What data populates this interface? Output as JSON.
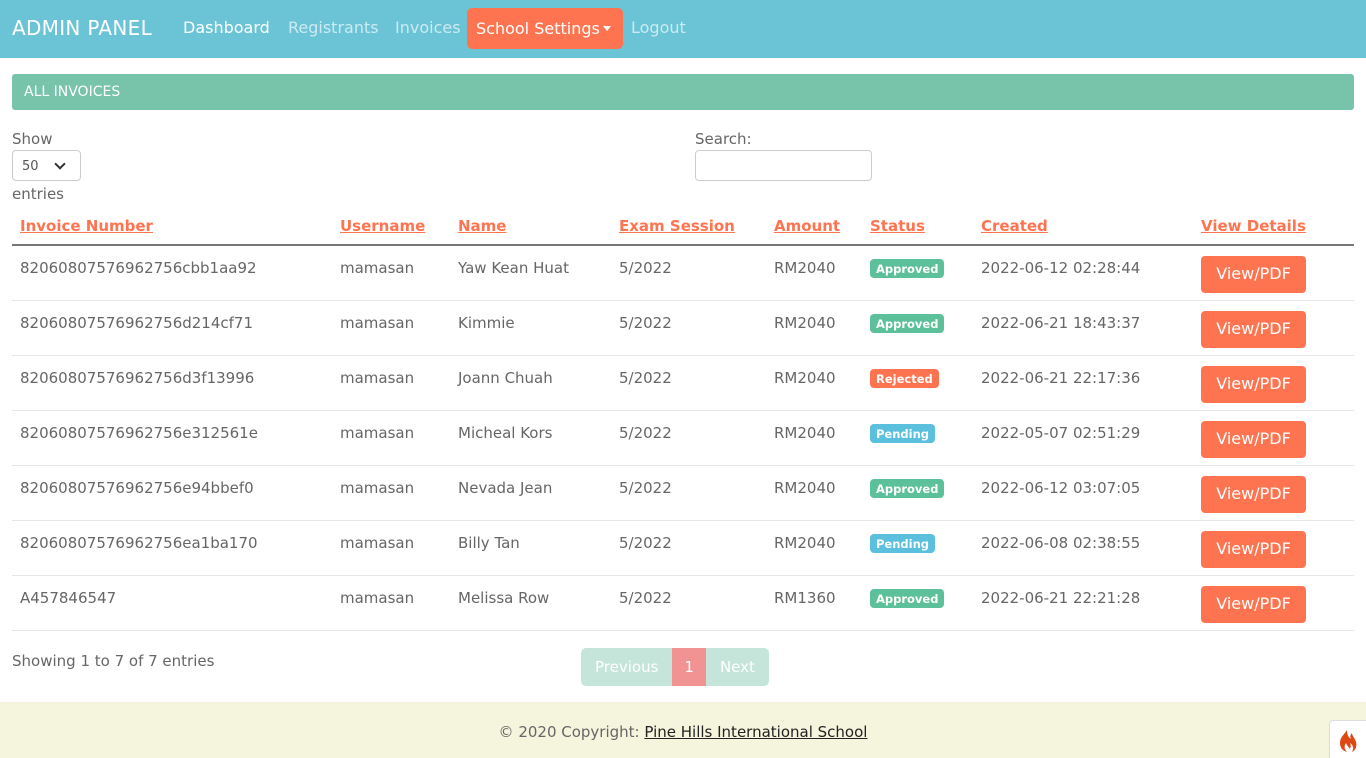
{
  "nav": {
    "brand": "ADMIN PANEL",
    "dashboard": "Dashboard",
    "registrants": "Registrants",
    "invoices": "Invoices",
    "school_settings": "School Settings",
    "logout": "Logout"
  },
  "card": {
    "title": "ALL INVOICES"
  },
  "controls": {
    "show_label": "Show",
    "entries_value": "50",
    "entries_label": "entries",
    "search_label": "Search:",
    "search_value": ""
  },
  "table": {
    "columns": [
      "Invoice Number",
      "Username",
      "Name",
      "Exam Session",
      "Amount",
      "Status",
      "Created",
      "View Details"
    ],
    "rows": [
      {
        "invoice": "82060807576962756cbb1aa92",
        "username": "mamasan",
        "name": "Yaw Kean Huat",
        "session": "5/2022",
        "amount": "RM2040",
        "status": "Approved",
        "created": "2022-06-12 02:28:44",
        "action": "View/PDF"
      },
      {
        "invoice": "82060807576962756d214cf71",
        "username": "mamasan",
        "name": "Kimmie",
        "session": "5/2022",
        "amount": "RM2040",
        "status": "Approved",
        "created": "2022-06-21 18:43:37",
        "action": "View/PDF"
      },
      {
        "invoice": "82060807576962756d3f13996",
        "username": "mamasan",
        "name": "Joann Chuah",
        "session": "5/2022",
        "amount": "RM2040",
        "status": "Rejected",
        "created": "2022-06-21 22:17:36",
        "action": "View/PDF"
      },
      {
        "invoice": "82060807576962756e312561e",
        "username": "mamasan",
        "name": "Micheal Kors",
        "session": "5/2022",
        "amount": "RM2040",
        "status": "Pending",
        "created": "2022-05-07 02:51:29",
        "action": "View/PDF"
      },
      {
        "invoice": "82060807576962756e94bbef0",
        "username": "mamasan",
        "name": "Nevada Jean",
        "session": "5/2022",
        "amount": "RM2040",
        "status": "Approved",
        "created": "2022-06-12 03:07:05",
        "action": "View/PDF"
      },
      {
        "invoice": "82060807576962756ea1ba170",
        "username": "mamasan",
        "name": "Billy Tan",
        "session": "5/2022",
        "amount": "RM2040",
        "status": "Pending",
        "created": "2022-06-08 02:38:55",
        "action": "View/PDF"
      },
      {
        "invoice": "A457846547",
        "username": "mamasan",
        "name": "Melissa Row",
        "session": "5/2022",
        "amount": "RM1360",
        "status": "Approved",
        "created": "2022-06-21 22:21:28",
        "action": "View/PDF"
      }
    ]
  },
  "pagination": {
    "info": "Showing 1 to 7 of 7 entries",
    "previous": "Previous",
    "current": "1",
    "next": "Next"
  },
  "footer": {
    "prefix": "© 2020 Copyright: ",
    "link": "Pine Hills International School"
  },
  "colors": {
    "navbar": "#6bc4d6",
    "accent": "#ff7450",
    "card_header": "#78c4aa",
    "approved": "#5cc09a",
    "rejected": "#ff7450",
    "pending": "#5bc0de"
  },
  "icons": {
    "corner_button": "codeigniter-flame-icon"
  }
}
